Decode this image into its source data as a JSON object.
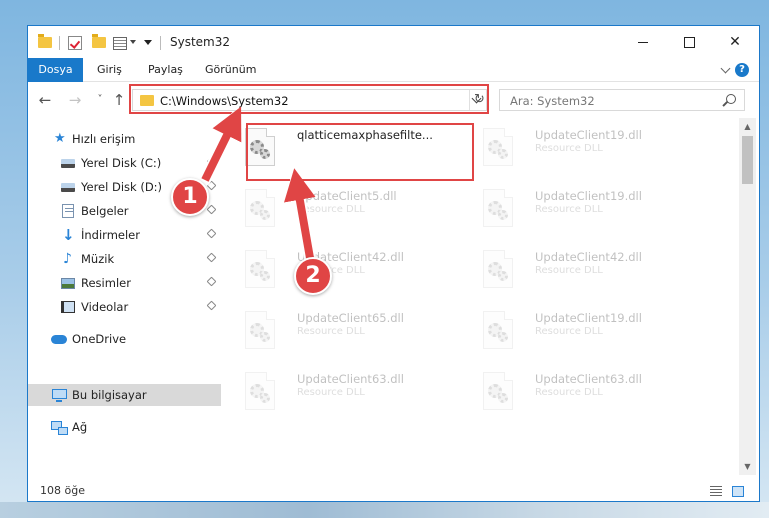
{
  "window": {
    "title": "System32",
    "controls": {
      "minimize": "—",
      "maximize": "□",
      "close": "✕"
    }
  },
  "ribbon": {
    "tabs": [
      "Dosya",
      "Giriş",
      "Paylaş",
      "Görünüm"
    ],
    "help": "?"
  },
  "nav": {
    "back": "←",
    "forward": "→",
    "recent": "˅",
    "up": "↑",
    "address": "C:\\Windows\\System32",
    "refresh": "↻",
    "search_placeholder": "Ara: System32"
  },
  "sidebar": {
    "quick_access": "Hızlı erişim",
    "items": [
      {
        "label": "Yerel Disk (C:)",
        "icon": "drive-icon",
        "pinned": true
      },
      {
        "label": "Yerel Disk (D:)",
        "icon": "drive-icon",
        "pinned": true
      },
      {
        "label": "Belgeler",
        "icon": "documents-icon",
        "pinned": true
      },
      {
        "label": "İndirmeler",
        "icon": "downloads-icon",
        "pinned": true
      },
      {
        "label": "Müzik",
        "icon": "music-icon",
        "pinned": true
      },
      {
        "label": "Resimler",
        "icon": "pictures-icon",
        "pinned": true
      },
      {
        "label": "Videolar",
        "icon": "videos-icon",
        "pinned": true
      }
    ],
    "onedrive": "OneDrive",
    "this_pc": "Bu bilgisayar",
    "network": "Ağ"
  },
  "files": {
    "highlighted": {
      "name": "qlatticemaxphasefilte...",
      "type": ""
    },
    "left_column": [
      {
        "name": "UpdateClient5.dll",
        "type": "Resource DLL"
      },
      {
        "name": "UpdateClient42.dll",
        "type": "Resource DLL"
      },
      {
        "name": "UpdateClient65.dll",
        "type": "Resource DLL"
      },
      {
        "name": "UpdateClient63.dll",
        "type": "Resource DLL"
      }
    ],
    "right_column": [
      {
        "name": "UpdateClient19.dll",
        "type": "Resource DLL"
      },
      {
        "name": "UpdateClient19.dll",
        "type": "Resource DLL"
      },
      {
        "name": "UpdateClient42.dll",
        "type": "Resource DLL"
      },
      {
        "name": "UpdateClient19.dll",
        "type": "Resource DLL"
      },
      {
        "name": "UpdateClient63.dll",
        "type": "Resource DLL"
      }
    ]
  },
  "status": {
    "count": "108 öğe"
  },
  "annotations": {
    "step1": "1",
    "step2": "2",
    "color": "#e04545"
  }
}
